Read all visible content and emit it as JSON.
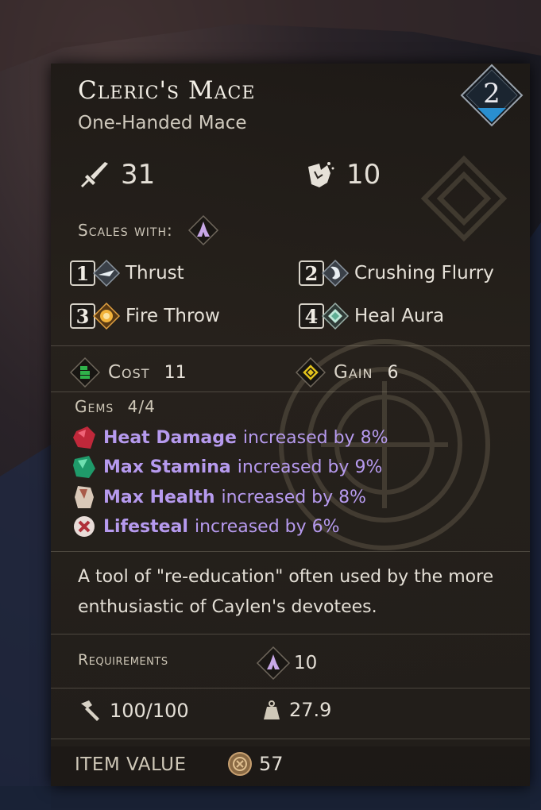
{
  "item": {
    "name": "Cleric's Mace",
    "type": "One-Handed Mace",
    "tier": "2"
  },
  "stats": {
    "damage": "31",
    "damage_icon": "sword-icon",
    "stagger": "10",
    "stagger_icon": "shatter-icon"
  },
  "scales_with": {
    "label": "Scales with:",
    "icon": "faith-hands-icon"
  },
  "skills": [
    {
      "key": "1",
      "name": "Thrust",
      "icon": "thrust-icon"
    },
    {
      "key": "2",
      "name": "Crushing Flurry",
      "icon": "crushing-flurry-icon"
    },
    {
      "key": "3",
      "name": "Fire Throw",
      "icon": "fire-throw-icon"
    },
    {
      "key": "4",
      "name": "Heal Aura",
      "icon": "heal-aura-icon"
    }
  ],
  "cost": {
    "label": "Cost",
    "value": "11"
  },
  "gain": {
    "label": "Gain",
    "value": "6"
  },
  "gems": {
    "label": "Gems",
    "count": "4/4",
    "items": [
      {
        "name": "Heat Damage",
        "text": "increased by 8%",
        "color": "#c0283a"
      },
      {
        "name": "Max Stamina",
        "text": "increased by 9%",
        "color": "#1f9a6a"
      },
      {
        "name": "Max Health",
        "text": "increased by 8%",
        "color": "#d9c8b8"
      },
      {
        "name": "Lifesteal",
        "text": "increased by 6%",
        "color": "#e8dcd8"
      }
    ]
  },
  "description": "A tool of \"re-education\" often used by the more enthusiastic of Caylen's devotees.",
  "requirements": {
    "label": "Requirements",
    "value": "10"
  },
  "durability": "100/100",
  "weight": "27.9",
  "item_value": {
    "label": "ITEM VALUE",
    "value": "57"
  },
  "colors": {
    "accent_purple": "#b69aee",
    "tier_blue": "#2a8fd0",
    "gain_yellow": "#e2c21c",
    "cost_green": "#2fb24a"
  }
}
